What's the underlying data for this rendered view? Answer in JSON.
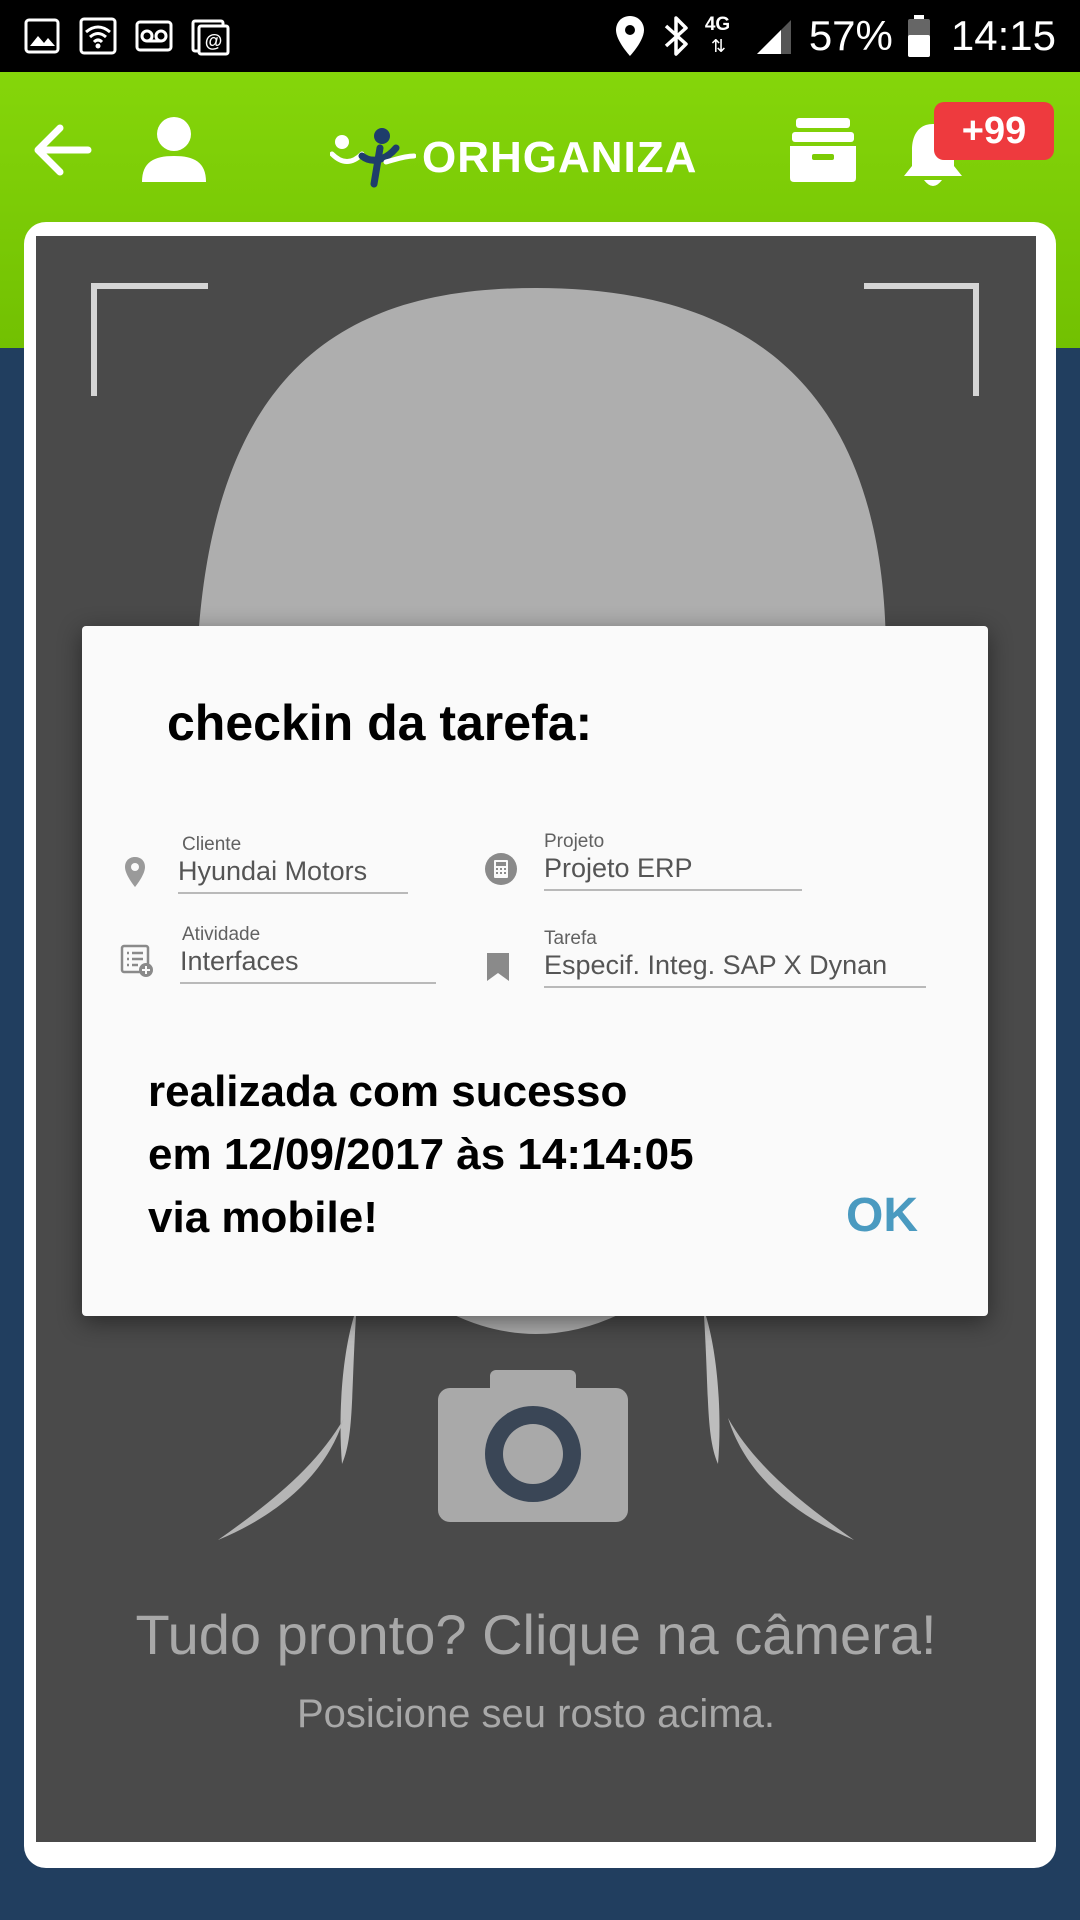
{
  "status_bar": {
    "icons": [
      "gallery-icon",
      "wifi-icon",
      "voicemail-icon",
      "email-icon",
      "location-icon",
      "bluetooth-icon",
      "network-icon",
      "signal-icon",
      "battery-icon"
    ],
    "network": "4G",
    "battery": "57%",
    "time": "14:15"
  },
  "app_bar": {
    "logo_text": "ORHGANIZA",
    "notification_badge": "+99",
    "color": "#7ccb05"
  },
  "dialog": {
    "title": "checkin da tarefa:",
    "fields": {
      "cliente": {
        "label": "Cliente",
        "value": "Hyundai Motors"
      },
      "projeto": {
        "label": "Projeto",
        "value": "Projeto ERP"
      },
      "atividade": {
        "label": "Atividade",
        "value": "Interfaces"
      },
      "tarefa": {
        "label": "Tarefa",
        "value": "Especif. Integ. SAP X Dynan"
      }
    },
    "message_lines": [
      "realizada com sucesso",
      "em 12/09/2017 às 14:14:05",
      "via mobile!"
    ],
    "ok_label": "OK"
  },
  "camera": {
    "hint_main": "Tudo pronto? Clique na câmera!",
    "hint_sub": "Posicione seu rosto acima."
  },
  "colors": {
    "header_green": "#7ccb05",
    "background_navy": "#213e5f",
    "badge_red": "#ee3a3e",
    "ok_blue": "#4a9ac0",
    "camera_gray": "#4a4a4a"
  }
}
